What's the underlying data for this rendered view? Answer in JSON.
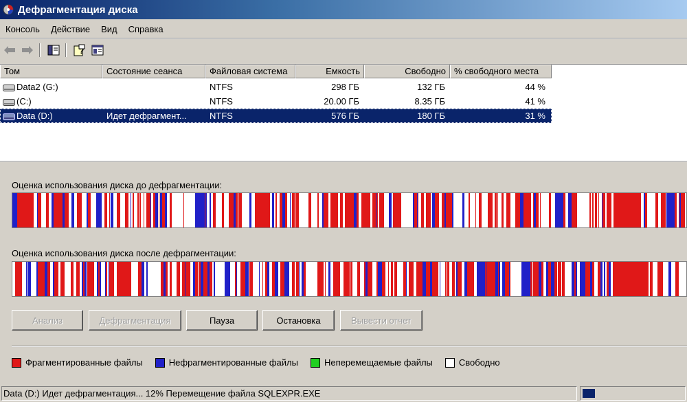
{
  "window": {
    "title": "Дефрагментация диска"
  },
  "menu": [
    "Консоль",
    "Действие",
    "Вид",
    "Справка"
  ],
  "toolbar": {
    "icons": [
      "back-arrow-icon",
      "forward-arrow-icon",
      "console-tree-icon",
      "help-icon",
      "properties-icon"
    ]
  },
  "volumes": {
    "columns": [
      "Том",
      "Состояние сеанса",
      "Файловая система",
      "Емкость",
      "Свободно",
      "% свободного места"
    ],
    "rows": [
      {
        "volume": "Data2 (G:)",
        "status": "",
        "fs": "NTFS",
        "capacity": "298 ГБ",
        "free": "132 ГБ",
        "pct": "44 %",
        "selected": false
      },
      {
        "volume": "(C:)",
        "status": "",
        "fs": "NTFS",
        "capacity": "20.00 ГБ",
        "free": "8.35 ГБ",
        "pct": "41 %",
        "selected": false
      },
      {
        "volume": "Data (D:)",
        "status": "Идет дефрагмент...",
        "fs": "NTFS",
        "capacity": "576 ГБ",
        "free": "180 ГБ",
        "pct": "31 %",
        "selected": true
      }
    ]
  },
  "analysis": {
    "before_label": "Оценка использования диска до дефрагментации:",
    "after_label": "Оценка использования диска после дефрагментации:"
  },
  "buttons": [
    {
      "label": "Анализ",
      "enabled": false
    },
    {
      "label": "Дефрагментация",
      "enabled": false
    },
    {
      "label": "Пауза",
      "enabled": true
    },
    {
      "label": "Остановка",
      "enabled": true
    },
    {
      "label": "Вывести отчет",
      "enabled": false
    }
  ],
  "legend": [
    {
      "label": "Фрагментированные файлы",
      "color": "#e01818"
    },
    {
      "label": "Нефрагментированные файлы",
      "color": "#2020c8"
    },
    {
      "label": "Неперемещаемые файлы",
      "color": "#20d020"
    },
    {
      "label": "Свободно",
      "color": "#ffffff"
    }
  ],
  "colors": {
    "fragmented": "#e01818",
    "contiguous": "#2020c8",
    "free": "#ffffff",
    "selection": "#0a246a"
  },
  "status": {
    "text": "Data (D:) Идет дефрагментация...  12%  Перемещение файла SQLEXPR.EXE",
    "progress": 0.12
  }
}
